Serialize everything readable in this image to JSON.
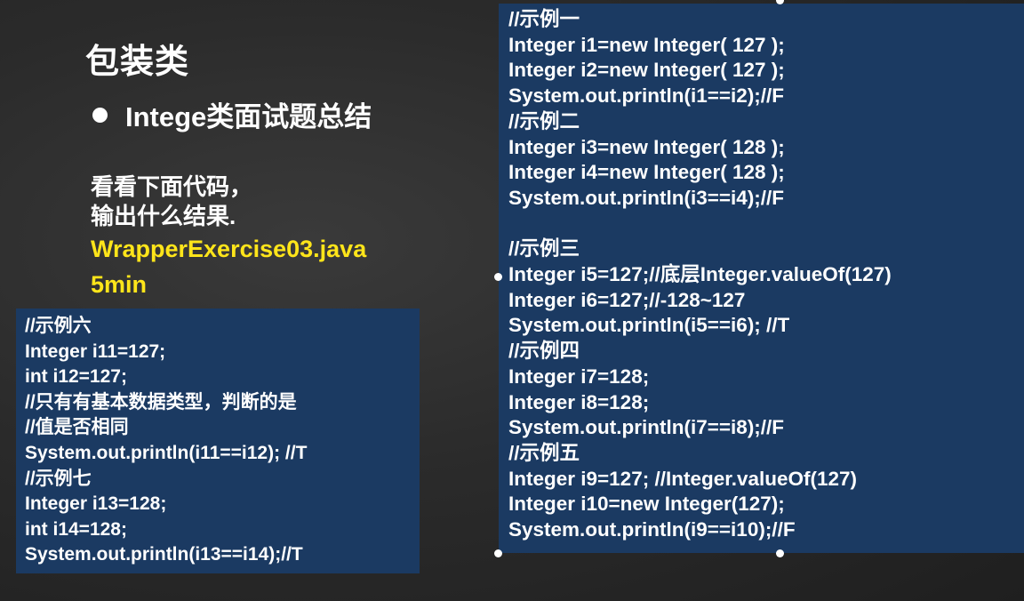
{
  "slide": {
    "title": "包装类",
    "bullet": "Intege类面试题总结",
    "desc_line1": "看看下面代码，",
    "desc_line2": "输出什么结果.",
    "file_name": "WrapperExercise03.java",
    "time": "5min"
  },
  "code_left": [
    "//示例六",
    "Integer i11=127;",
    "int i12=127;",
    "//只有有基本数据类型，判断的是",
    "//值是否相同",
    "System.out.println(i11==i12); //T",
    "//示例七",
    "Integer i13=128;",
    "int i14=128;",
    "System.out.println(i13==i14);//T"
  ],
  "code_right": [
    "//示例一",
    "Integer i1=new Integer( 127 );",
    "Integer i2=new Integer( 127 );",
    "System.out.println(i1==i2);//F",
    "//示例二",
    "Integer i3=new Integer( 128 );",
    "Integer i4=new Integer( 128 );",
    "System.out.println(i3==i4);//F",
    "",
    "//示例三",
    "Integer i5=127;//底层Integer.valueOf(127)",
    "Integer i6=127;//-128~127",
    "System.out.println(i5==i6); //T",
    "//示例四",
    "Integer i7=128;",
    "Integer i8=128;",
    "System.out.println(i7==i8);//F",
    "//示例五",
    "Integer i9=127; //Integer.valueOf(127)",
    "Integer i10=new Integer(127);",
    "System.out.println(i9==i10);//F"
  ],
  "colors": {
    "background": "#2b2b2b",
    "code_box": "#1b3a62",
    "highlight_text": "#ffe51a",
    "text": "#ffffff"
  }
}
